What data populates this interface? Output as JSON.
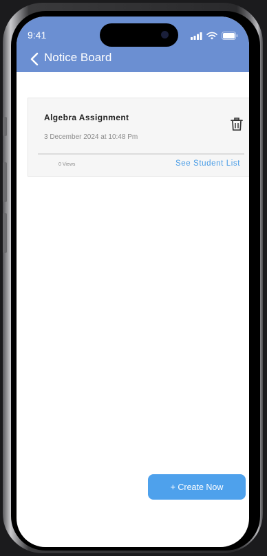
{
  "status_bar": {
    "time": "9:41"
  },
  "header": {
    "title": "Notice Board"
  },
  "notice": {
    "title": "Algebra Assignment",
    "date": "3 December 2024 at 10:48 Pm",
    "views": "0 Views",
    "link_label": "See Student List"
  },
  "actions": {
    "create_label": "+ Create Now"
  },
  "colors": {
    "header_bg": "#6b8fd2",
    "link": "#4a9de6",
    "primary_button": "#4ea1ec"
  },
  "icons": {
    "back": "chevron-left-icon",
    "delete": "trash-icon",
    "signal": "signal-icon",
    "wifi": "wifi-icon",
    "battery": "battery-icon"
  }
}
